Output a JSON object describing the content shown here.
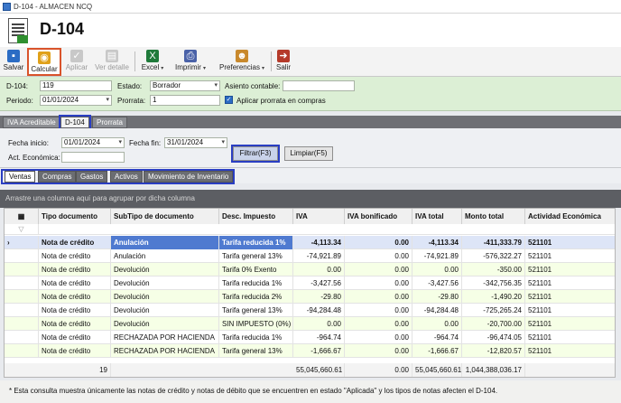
{
  "window": {
    "title": "D-104 - ALMACEN NCQ"
  },
  "document": {
    "title": "D-104"
  },
  "toolbar": [
    {
      "label": "Salvar",
      "icon": "save-icon",
      "color": "#2b6cc4",
      "enabled": true
    },
    {
      "label": "Calcular",
      "icon": "calculate-icon",
      "color": "#e0a11a",
      "enabled": true,
      "highlighted": true
    },
    {
      "label": "Aplicar",
      "icon": "checkmark-icon",
      "color": "#b8b8b8",
      "enabled": false
    },
    {
      "label": "Ver detalle",
      "icon": "document-icon",
      "color": "#b8b8b8",
      "enabled": false
    },
    {
      "label": "Excel",
      "icon": "excel-icon",
      "color": "#1f7a3a",
      "enabled": true,
      "dropdown": true
    },
    {
      "label": "Imprimir",
      "icon": "printer-icon",
      "color": "#4a62a8",
      "enabled": true,
      "dropdown": true
    },
    {
      "label": "Preferencias",
      "icon": "user-settings-icon",
      "color": "#c9892c",
      "enabled": true,
      "dropdown": true
    },
    {
      "label": "Salir",
      "icon": "exit-icon",
      "color": "#b53a2a",
      "enabled": true
    }
  ],
  "form": {
    "d104_label": "D-104:",
    "d104_value": "119",
    "periodo_label": "Periodo:",
    "periodo_value": "01/01/2024",
    "estado_label": "Estado:",
    "estado_value": "Borrador",
    "prorrata_label": "Prorrata:",
    "prorrata_value": "1",
    "asiento_label": "Asiento contable:",
    "asiento_value": "",
    "aplicar_prorrata_label": "Aplicar prorrata en compras",
    "aplicar_prorrata_checked": true
  },
  "top_tabs": [
    "IVA Acreditable",
    "D-104",
    "Prorrata"
  ],
  "filters": {
    "fecha_inicio_label": "Fecha inicio:",
    "fecha_inicio_value": "01/01/2024",
    "fecha_fin_label": "Fecha fin:",
    "fecha_fin_value": "31/01/2024",
    "act_economica_label": "Act. Económica:",
    "act_economica_value": "",
    "filtrar_label": "Filtrar(F3)",
    "limpiar_label": "Limpiar(F5)"
  },
  "sub_tabs": [
    "Ventas",
    "Compras",
    "Gastos",
    "Activos",
    "Movimiento de Inventario"
  ],
  "group_hint": "Arrastre una columna aquí para agrupar por dicha columna",
  "grid": {
    "columns": [
      "Tipo documento",
      "SubTipo de documento",
      "Desc. Impuesto",
      "IVA",
      "IVA bonificado",
      "IVA total",
      "Monto total",
      "Actividad Económica"
    ],
    "rows": [
      [
        "Nota de crédito",
        "Anulación",
        "Tarifa reducida 1%",
        "-4,113.34",
        "0.00",
        "-4,113.34",
        "-411,333.79",
        "521101"
      ],
      [
        "Nota de crédito",
        "Anulación",
        "Tarifa general 13%",
        "-74,921.89",
        "0.00",
        "-74,921.89",
        "-576,322.27",
        "521101"
      ],
      [
        "Nota de crédito",
        "Devolución",
        "Tarifa 0% Exento",
        "0.00",
        "0.00",
        "0.00",
        "-350.00",
        "521101"
      ],
      [
        "Nota de crédito",
        "Devolución",
        "Tarifa reducida 1%",
        "-3,427.56",
        "0.00",
        "-3,427.56",
        "-342,756.35",
        "521101"
      ],
      [
        "Nota de crédito",
        "Devolución",
        "Tarifa reducida 2%",
        "-29.80",
        "0.00",
        "-29.80",
        "-1,490.20",
        "521101"
      ],
      [
        "Nota de crédito",
        "Devolución",
        "Tarifa general 13%",
        "-94,284.48",
        "0.00",
        "-94,284.48",
        "-725,265.24",
        "521101"
      ],
      [
        "Nota de crédito",
        "Devolución",
        "SIN IMPUESTO (0%)",
        "0.00",
        "0.00",
        "0.00",
        "-20,700.00",
        "521101"
      ],
      [
        "Nota de crédito",
        "RECHAZADA POR HACIENDA",
        "Tarifa reducida 1%",
        "-964.74",
        "0.00",
        "-964.74",
        "-96,474.05",
        "521101"
      ],
      [
        "Nota de crédito",
        "RECHAZADA POR HACIENDA",
        "Tarifa general 13%",
        "-1,666.67",
        "0.00",
        "-1,666.67",
        "-12,820.57",
        "521101"
      ]
    ],
    "footer": {
      "count": "19",
      "iva": "55,045,660.61",
      "iva_bonificado": "0.00",
      "iva_total": "55,045,660.61",
      "monto_total": "1,044,388,036.17"
    }
  },
  "note": "* Esta consulta muestra únicamente las notas de crédito y notas de débito que se encuentren en estado \"Aplicada\" y los tipos de notas afecten el D-104."
}
